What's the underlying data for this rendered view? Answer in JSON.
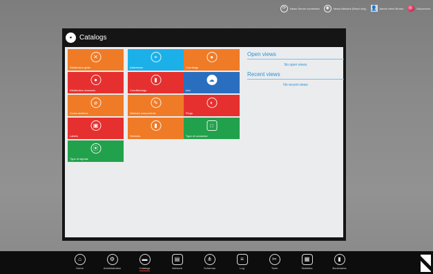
{
  "status_bar": {
    "items": [
      {
        "icon": "server-icon",
        "label": "Newo Server connected"
      },
      {
        "icon": "network-icon",
        "label": "Newo Network (Read only)"
      },
      {
        "icon": "user-icon",
        "label": "Admin Henri Broms"
      },
      {
        "icon": "logout-icon",
        "label": "Disconnect"
      }
    ]
  },
  "window": {
    "title": "Catalogs",
    "tiles": [
      {
        "label": "Distribution grids",
        "color": "#f07b26",
        "icon": "x-circle-icon"
      },
      {
        "label": "Addresses",
        "color": "#1cb0e8",
        "icon": "address-icon"
      },
      {
        "label": "Countings",
        "color": "#f07b26",
        "icon": "counter-icon"
      },
      {
        "label": "Distribution channels",
        "color": "#e6302f",
        "icon": "apple-icon"
      },
      {
        "label": "Conditionings",
        "color": "#e6302f",
        "icon": "conditioning-icon"
      },
      {
        "label": "Info",
        "color": "#2a6fbf",
        "icon": "cloud-icon"
      },
      {
        "label": "Cross-sections",
        "color": "#f07b26",
        "icon": "cross-section-icon"
      },
      {
        "label": "Network components",
        "color": "#f07b26",
        "icon": "pencil-icon"
      },
      {
        "label": "Plugs",
        "color": "#e6302f",
        "icon": "plug-icon"
      },
      {
        "label": "Labels",
        "color": "#e6302f",
        "icon": "label-icon"
      },
      {
        "label": "Services",
        "color": "#f07b26",
        "icon": "service-icon"
      },
      {
        "label": "Type of connector",
        "color": "#22a14c",
        "icon": "connector-icon"
      },
      {
        "label": "Type of signals",
        "color": "#22a14c",
        "icon": "signal-icon"
      }
    ],
    "open_views": {
      "heading": "Open views",
      "empty": "No open views"
    },
    "recent_views": {
      "heading": "Recent views",
      "empty": "No recent views"
    }
  },
  "taskbar": {
    "items": [
      {
        "label": "Home",
        "icon": "home-icon"
      },
      {
        "label": "Administration",
        "icon": "administration-icon"
      },
      {
        "label": "Catalogs",
        "icon": "catalogs-icon",
        "active": true
      },
      {
        "label": "Network",
        "icon": "network-icon"
      },
      {
        "label": "Schemas",
        "icon": "schemas-icon"
      },
      {
        "label": "Log",
        "icon": "log-icon"
      },
      {
        "label": "Tools",
        "icon": "tools-icon"
      },
      {
        "label": "Statistics",
        "icon": "statistics-icon"
      },
      {
        "label": "Bookmarks",
        "icon": "bookmarks-icon"
      }
    ]
  }
}
